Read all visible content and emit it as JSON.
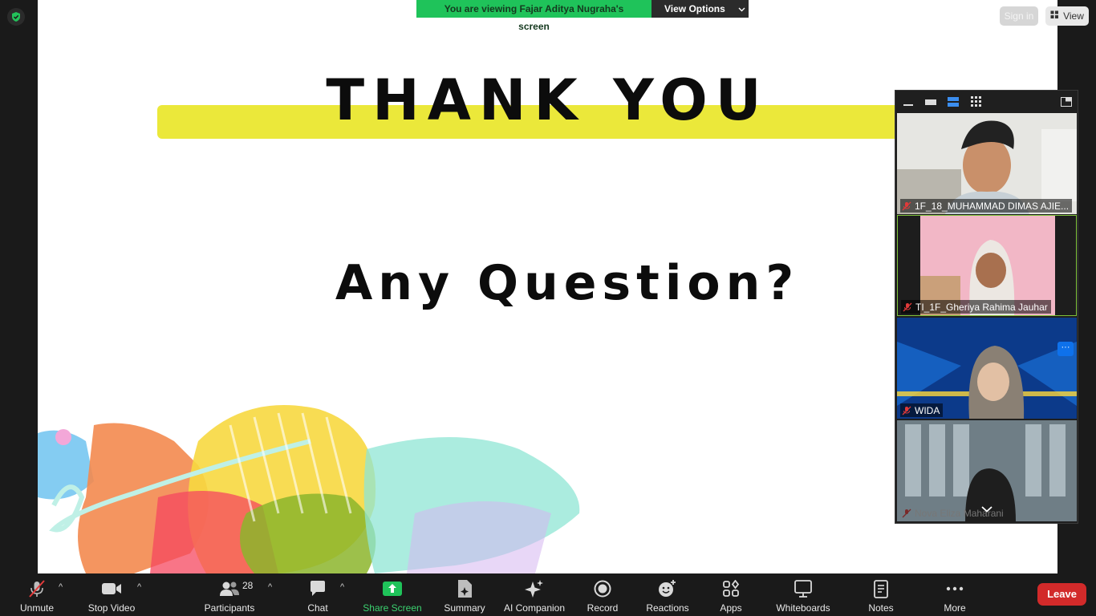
{
  "banner": {
    "viewing_text": "You are viewing Fajar  Aditya Nugraha's screen",
    "view_options_label": "View Options"
  },
  "top_right": {
    "sign_in_label": "Sign in",
    "view_label": "View"
  },
  "slide": {
    "heading": "THANK YOU",
    "subheading": "Any Question?"
  },
  "gallery": {
    "participants": [
      {
        "name": "1F_18_MUHAMMAD DIMAS AJIE...",
        "muted": true
      },
      {
        "name": "TI_1F_Gheriya Rahima Jauhar",
        "muted": true
      },
      {
        "name": "WIDA",
        "muted": true
      },
      {
        "name": "Nova Eliza Maharani",
        "muted": true
      }
    ],
    "tile_more_label": "···"
  },
  "toolbar": {
    "unmute_label": "Unmute",
    "stop_video_label": "Stop Video",
    "participants_label": "Participants",
    "participants_count": "28",
    "chat_label": "Chat",
    "share_screen_label": "Share Screen",
    "summary_label": "Summary",
    "ai_companion_label": "AI Companion",
    "record_label": "Record",
    "reactions_label": "Reactions",
    "apps_label": "Apps",
    "whiteboards_label": "Whiteboards",
    "notes_label": "Notes",
    "more_label": "More",
    "leave_label": "Leave"
  },
  "colors": {
    "banner_green": "#1fc35a",
    "share_green": "#1fc35a",
    "leave_red": "#d22a2a",
    "highlight_yellow": "#ebe83a",
    "active_tile_border": "#7ec23a"
  }
}
